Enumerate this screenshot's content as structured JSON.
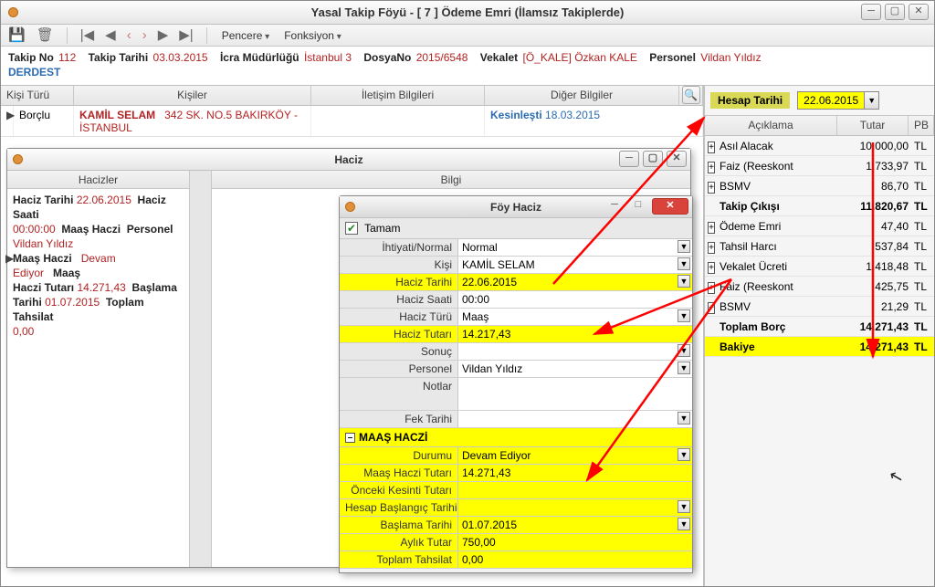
{
  "window_title": "Yasal Takip Föyü - [ 7 ] Ödeme Emri (İlamsız Takiplerde)",
  "toolbar": {
    "menus": [
      "Pencere",
      "Fonksiyon"
    ]
  },
  "infobar": {
    "takip_no_lbl": "Takip No",
    "takip_no": "112",
    "takip_tarihi_lbl": "Takip Tarihi",
    "takip_tarihi": "03.03.2015",
    "icra_lbl": "İcra Müdürlüğü",
    "icra": "İstanbul 3",
    "dosya_lbl": "DosyaNo",
    "dosya": "2015/6548",
    "vekalet_lbl": "Vekalet",
    "vekalet": "[Ö_KALE] Özkan KALE",
    "personel_lbl": "Personel",
    "personel": "Vildan Yıldız",
    "durum": "DERDEST"
  },
  "grid_headers": {
    "kisi_turu": "Kişi Türü",
    "kisiler": "Kişiler",
    "iletisim": "İletişim Bilgileri",
    "diger": "Diğer Bilgiler"
  },
  "grid_row": {
    "kisi_turu": "Borçlu",
    "ad": "KAMİL SELAM",
    "adres": "342 SK. NO.5   BAKIRKÖY   - İSTANBUL",
    "kesin_lbl": "Kesinleşti",
    "kesin_tarih": "18.03.2015"
  },
  "haciz": {
    "title": "Haciz",
    "tabs": [
      "Hacizler",
      "Bilgi"
    ],
    "list_text": {
      "l1a": "Haciz Tarihi",
      "l1b": "22.06.2015",
      "l1c": "Haciz Saati",
      "l2a": "00:00:00",
      "l2b": "Maaş Haczi",
      "l2c": "Personel",
      "l3": "Vildan Yıldız",
      "l4a": "Maaş Haczi",
      "l4b": "Devam Ediyor",
      "l4c": "Maaş",
      "l5a": "Haczi Tutarı",
      "l5b": "14.271,43",
      "l5c": "Başlama",
      "l6a": "Tarihi",
      "l6b": "01.07.2015",
      "l6c": "Toplam Tahsilat",
      "l7": "0,00"
    }
  },
  "foy": {
    "title": "Föy Haciz",
    "tamam": "Tamam",
    "rows": [
      {
        "label": "İhtiyati/Normal",
        "value": "Normal",
        "dd": true
      },
      {
        "label": "Kişi",
        "value": "KAMİL SELAM",
        "dd": true
      },
      {
        "label": "Haciz Tarihi",
        "value": "22.06.2015",
        "dd": true,
        "hl": "label_field"
      },
      {
        "label": "Haciz Saati",
        "value": "00:00"
      },
      {
        "label": "Haciz Türü",
        "value": "Maaş",
        "dd": true
      },
      {
        "label": "Haciz Tutarı",
        "value": "14.217,43",
        "hl": "label_field"
      },
      {
        "label": "Sonuç",
        "value": "",
        "dd": true
      },
      {
        "label": "Personel",
        "value": "Vildan Yıldız",
        "dd": true
      },
      {
        "label": "Notlar",
        "value": "",
        "tall": true
      },
      {
        "label": "Fek Tarihi",
        "value": "",
        "dd": true
      }
    ],
    "group": "MAAŞ HACZİ",
    "grows": [
      {
        "label": "Durumu",
        "value": "Devam Ediyor",
        "dd": true
      },
      {
        "label": "Maaş Haczi Tutarı",
        "value": "14.271,43"
      },
      {
        "label": "Önceki Kesinti Tutarı",
        "value": ""
      },
      {
        "label": "Hesap Başlangıç Tarihi",
        "value": "",
        "dd": true
      },
      {
        "label": "Başlama Tarihi",
        "value": "01.07.2015",
        "dd": true
      },
      {
        "label": "Aylık Tutar",
        "value": "750,00"
      },
      {
        "label": "Toplam Tahsilat",
        "value": "0,00"
      }
    ]
  },
  "right": {
    "hesap_tarihi_lbl": "Hesap Tarihi",
    "hesap_tarihi": "22.06.2015",
    "headers": {
      "aciklama": "Açıklama",
      "tutar": "Tutar",
      "pb": "PB"
    },
    "rows": [
      {
        "pm": "+",
        "name": "Asıl Alacak",
        "amt": "10.000,00",
        "unit": "TL"
      },
      {
        "pm": "+",
        "name": "Faiz (Reeskont",
        "amt": "1.733,97",
        "unit": "TL"
      },
      {
        "pm": "+",
        "name": "BSMV",
        "amt": "86,70",
        "unit": "TL"
      },
      {
        "pm": "",
        "name": "Takip Çıkışı",
        "amt": "11.820,67",
        "unit": "TL",
        "bold": true
      },
      {
        "pm": "+",
        "name": "Ödeme Emri",
        "amt": "47,40",
        "unit": "TL"
      },
      {
        "pm": "+",
        "name": "Tahsil Harcı",
        "amt": "537,84",
        "unit": "TL"
      },
      {
        "pm": "+",
        "name": "Vekalet Ücreti",
        "amt": "1.418,48",
        "unit": "TL"
      },
      {
        "pm": "+",
        "name": "Faiz (Reeskont",
        "amt": "425,75",
        "unit": "TL"
      },
      {
        "pm": "+",
        "name": "BSMV",
        "amt": "21,29",
        "unit": "TL"
      },
      {
        "pm": "",
        "name": "Toplam Borç",
        "amt": "14.271,43",
        "unit": "TL",
        "bold": true
      },
      {
        "pm": "",
        "name": "Bakiye",
        "amt": "14.271,43",
        "unit": "TL",
        "bold": true,
        "hl": true
      }
    ]
  }
}
